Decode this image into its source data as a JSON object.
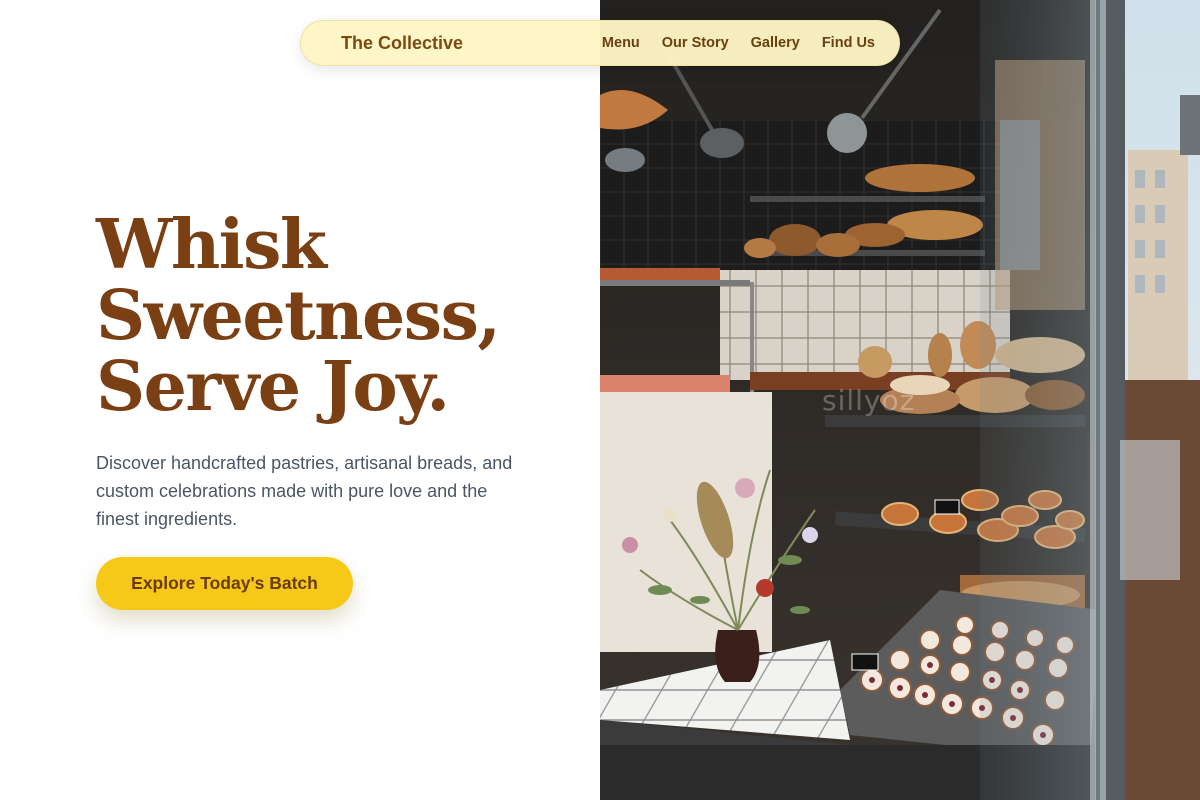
{
  "nav": {
    "brand": "The Collective",
    "links": [
      "Menu",
      "Our Story",
      "Gallery",
      "Find Us"
    ]
  },
  "hero": {
    "headline": [
      "Whisk",
      "Sweetness,",
      "Serve Joy."
    ],
    "description": "Discover handcrafted pastries, artisanal breads, and custom celebrations made with pure love and the finest ingredients.",
    "cta_label": "Explore Today's Batch"
  },
  "photo": {
    "watermark": "sillyoz"
  },
  "colors": {
    "accent": "#f6c817",
    "brand_brown": "#7b3f14",
    "nav_bg": "#fef6c4",
    "body_text": "#4b5563"
  }
}
